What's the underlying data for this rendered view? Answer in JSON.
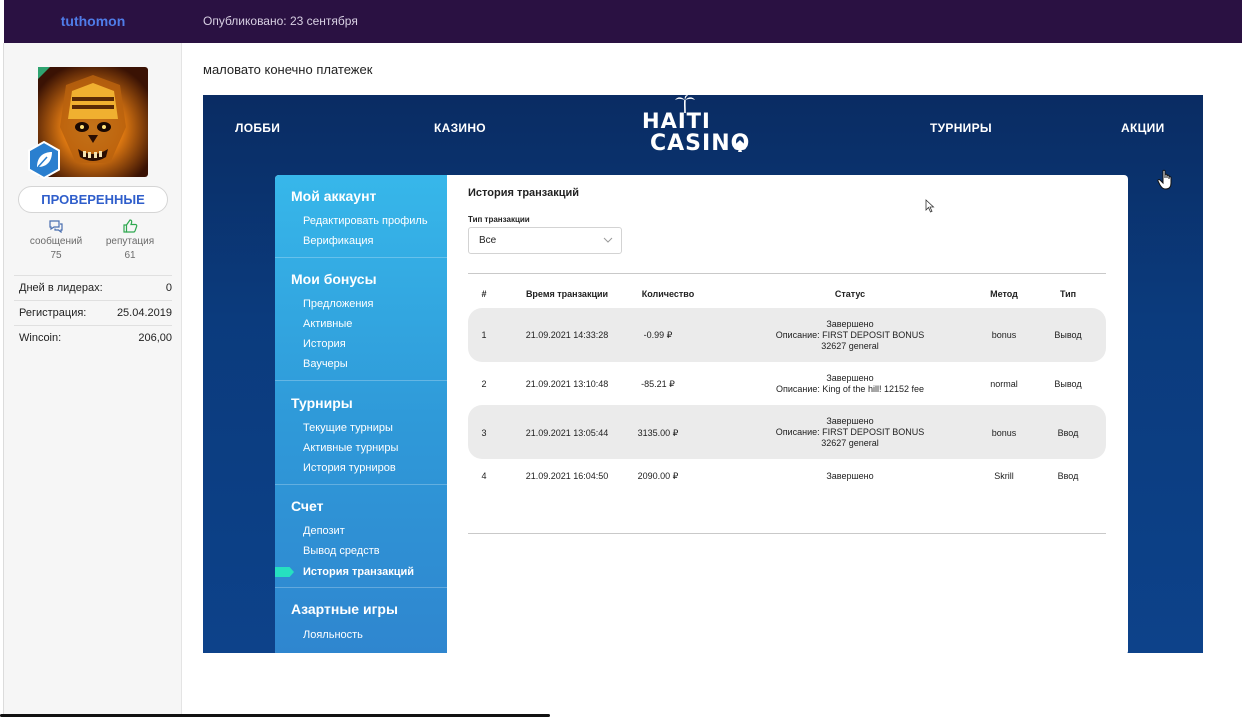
{
  "header": {
    "username": "tuthomon",
    "published": "Опубликовано: 23 сентября"
  },
  "profile": {
    "group": "ПРОВЕРЕННЫЕ",
    "stats": [
      {
        "label": "сообщений",
        "value": "75"
      },
      {
        "label": "репутация",
        "value": "61"
      }
    ],
    "info": [
      {
        "label": "Дней в лидерах:",
        "value": "0"
      },
      {
        "label": "Регистрация:",
        "value": "25.04.2019"
      },
      {
        "label": "Wincoin:",
        "value": "206,00"
      }
    ]
  },
  "post": {
    "text": "маловато конечно платежек"
  },
  "casino": {
    "nav": [
      "ЛОББИ",
      "КАЗИНО",
      "ТУРНИРЫ",
      "АКЦИИ"
    ],
    "logo": {
      "line1": "HAITI",
      "line2": "CASINO"
    },
    "menu": [
      {
        "title": "Мой аккаунт",
        "items": [
          "Редактировать профиль",
          "Верификация"
        ]
      },
      {
        "title": "Мои бонусы",
        "items": [
          "Предложения",
          "Активные",
          "История",
          "Ваучеры"
        ]
      },
      {
        "title": "Турниры",
        "items": [
          "Текущие турниры",
          "Активные турниры",
          "История турниров"
        ]
      },
      {
        "title": "Счет",
        "items": [
          "Депозит",
          "Вывод средств",
          "История транзакций"
        ]
      },
      {
        "title": "Азартные игры",
        "items": [
          "Лояльность"
        ]
      }
    ],
    "active_item": "История транзакций",
    "content_title": "История транзакций",
    "filter": {
      "label": "Тип транзакции",
      "value": "Все"
    },
    "table": {
      "headers": [
        "#",
        "Время транзакции",
        "Количество",
        "Статус",
        "Метод",
        "Тип"
      ],
      "rows": [
        {
          "n": "1",
          "time": "21.09.2021 14:33:28",
          "amount": "-0.99 ₽",
          "status": [
            "Завершено",
            "Описание: FIRST DEPOSIT BONUS",
            "32627 general"
          ],
          "method": "bonus",
          "type": "Вывод"
        },
        {
          "n": "2",
          "time": "21.09.2021 13:10:48",
          "amount": "-85.21 ₽",
          "status": [
            "Завершено",
            "Описание: King of the hill! 12152 fee"
          ],
          "method": "normal",
          "type": "Вывод"
        },
        {
          "n": "3",
          "time": "21.09.2021 13:05:44",
          "amount": "3135.00 ₽",
          "status": [
            "Завершено",
            "Описание: FIRST DEPOSIT BONUS",
            "32627 general"
          ],
          "method": "bonus",
          "type": "Ввод"
        },
        {
          "n": "4",
          "time": "21.09.2021 16:04:50",
          "amount": "2090.00 ₽",
          "status": [
            "Завершено"
          ],
          "method": "Skrill",
          "type": "Ввод"
        }
      ]
    }
  }
}
